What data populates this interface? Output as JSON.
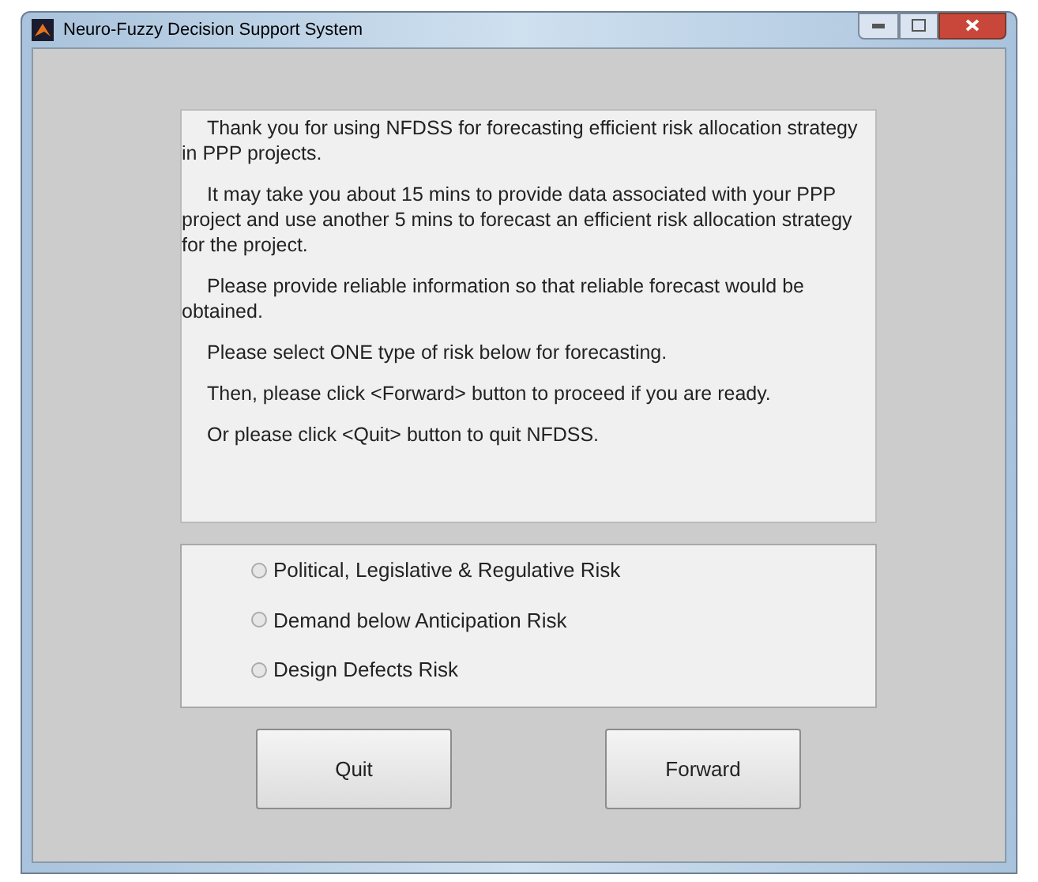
{
  "window": {
    "title": "Neuro-Fuzzy Decision Support System"
  },
  "intro": [
    "Thank you for using NFDSS for forecasting efficient risk allocation strategy in PPP projects.",
    "It may take you about 15 mins to provide data associated with your PPP project and use another 5 mins to forecast an efficient risk allocation strategy for the project.",
    "Please provide reliable information so that reliable forecast would be obtained.",
    "Please select ONE type of risk below for forecasting.",
    "Then, please click <Forward> button to proceed if you are ready.",
    "Or please click <Quit> button to quit NFDSS."
  ],
  "risk_options": [
    {
      "label": "Political, Legislative & Regulative Risk",
      "selected": false
    },
    {
      "label": "Demand below Anticipation Risk",
      "selected": false
    },
    {
      "label": "Design Defects Risk",
      "selected": false
    }
  ],
  "buttons": [
    "Quit",
    "Forward"
  ]
}
